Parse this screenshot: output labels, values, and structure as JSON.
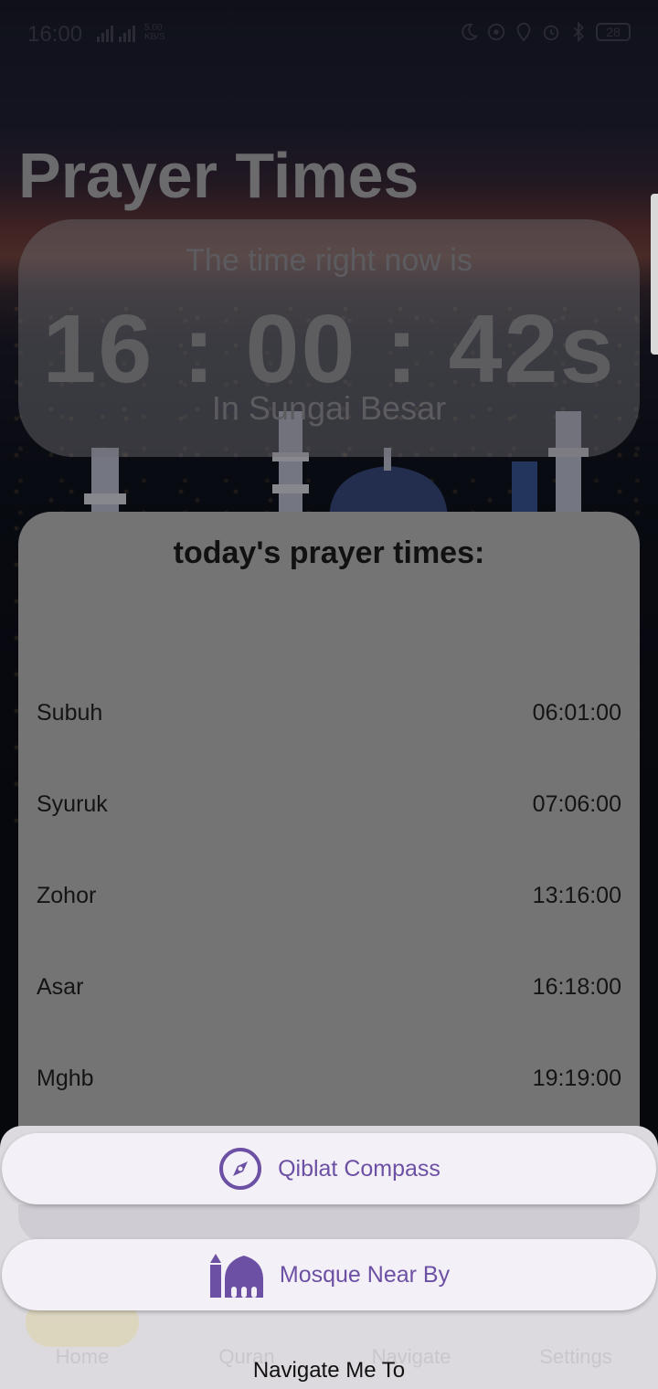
{
  "status_bar": {
    "time": "16:00",
    "net_speed": "5.00\nKB/S",
    "battery": "28"
  },
  "page": {
    "title": "Prayer Times"
  },
  "clock": {
    "caption": "The time right now is",
    "time": "16 : 00 : 42s",
    "location": "In Sungai Besar"
  },
  "prayer_card": {
    "title": "today's prayer times:",
    "rows": [
      {
        "name": "Subuh",
        "time": "06:01:00"
      },
      {
        "name": "Syuruk",
        "time": "07:06:00"
      },
      {
        "name": "Zohor",
        "time": "13:16:00"
      },
      {
        "name": "Asar",
        "time": "16:18:00"
      },
      {
        "name": "Mghb",
        "time": "19:19:00"
      }
    ]
  },
  "actions": {
    "qiblat_label": "Qiblat Compass",
    "mosque_label": "Mosque Near By",
    "sheet_label": "Navigate Me To"
  },
  "bottom_nav": {
    "items": [
      {
        "label": "Home",
        "icon": "home-icon"
      },
      {
        "label": "Quran",
        "icon": "book-icon"
      },
      {
        "label": "Navigate",
        "icon": "map-icon"
      },
      {
        "label": "Settings",
        "icon": "gear-icon"
      }
    ]
  },
  "colors": {
    "accent": "#6c50a4",
    "card": "#747474",
    "button_bg": "#f4f0f7"
  }
}
